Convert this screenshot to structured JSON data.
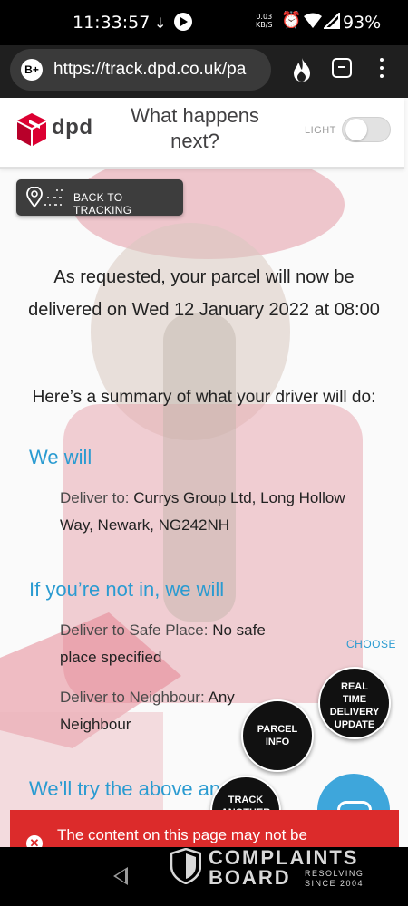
{
  "status_bar": {
    "time": "11:33:57",
    "net_speed_value": "0.03",
    "net_speed_unit": "KB/S",
    "battery": "93%",
    "icons": [
      "download-icon",
      "play-icon",
      "alarm-icon",
      "wifi-icon",
      "signal-icon"
    ]
  },
  "browser": {
    "site_badge": "B+",
    "url": "https://track.dpd.co.uk/pa",
    "icons": [
      "flame-icon",
      "tab-icon",
      "menu-icon"
    ]
  },
  "header": {
    "logo_text": "dpd",
    "title": "What happens next?",
    "theme_toggle_label": "LIGHT"
  },
  "back_button": {
    "label": "BACK TO TRACKING"
  },
  "message": "As requested, your parcel will now be delivered on Wed 12 January 2022 at 08:00",
  "summary": "Here’s a summary of what your driver will do:",
  "we_will": {
    "heading": "We will",
    "deliver_to_label": "Deliver to:",
    "deliver_to_value": "Currys Group Ltd, Long Hollow Way, Newark, NG242NH"
  },
  "not_in": {
    "heading": "If you’re not in, we will",
    "safe_place_label": "Deliver to Safe Place:",
    "safe_place_value": "No safe place specified",
    "neighbour_label": "Deliver to Neighbour:",
    "neighbour_value": "Any Neighbour",
    "choose_label": "CHOOSE"
  },
  "try_heading": "We’ll try the above an",
  "fabs": {
    "rtu_line1": "REAL",
    "rtu_line2": "TIME",
    "rtu_line3": "DELIVERY",
    "rtu_line4": "UPDATE",
    "parcel_line1": "PARCEL",
    "parcel_line2": "INFO",
    "track_line1": "TRACK",
    "track_line2": "ANOTHER"
  },
  "alert": {
    "text": "The content on this page may not be"
  },
  "watermark": {
    "line1": "COMPLAINTS",
    "line2": "BOARD",
    "tag1": "RESOLVING",
    "tag2": "SINCE 2004"
  },
  "colors": {
    "dpd_red": "#dc0032",
    "heading_blue": "#2a9bd1",
    "alert_red": "#dc2b2b"
  }
}
